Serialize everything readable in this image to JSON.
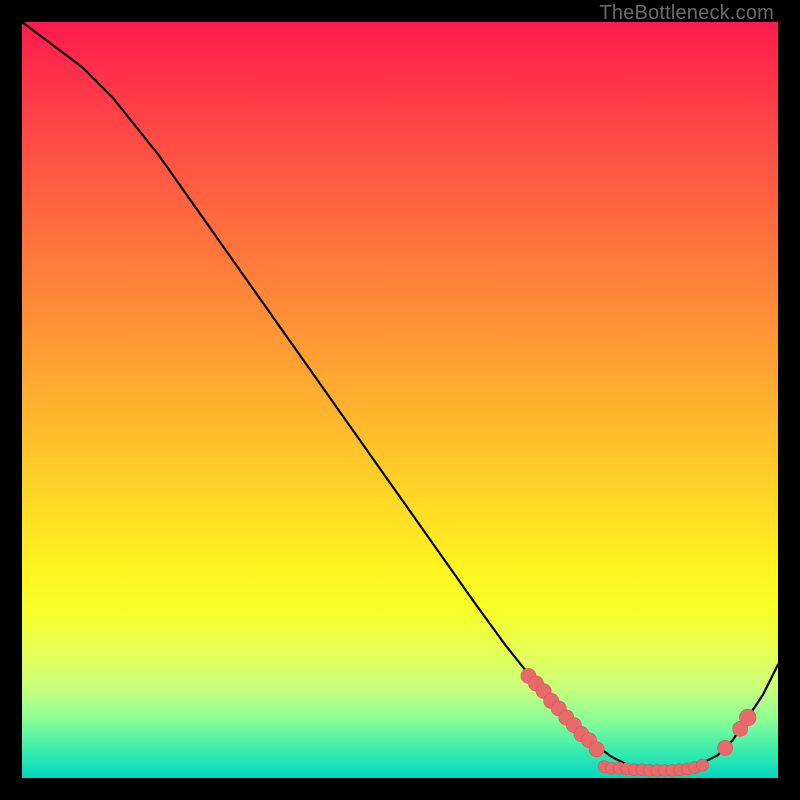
{
  "attribution": "TheBottleneck.com",
  "colors": {
    "curve_stroke": "#000000",
    "marker_fill": "#e86a6a",
    "marker_stroke": "#d45858",
    "background_black": "#000000"
  },
  "chart_data": {
    "type": "line",
    "title": "",
    "xlabel": "",
    "ylabel": "",
    "xlim": [
      0,
      100
    ],
    "ylim": [
      0,
      100
    ],
    "grid": false,
    "legend": false,
    "series": [
      {
        "name": "curve",
        "x": [
          0,
          4,
          8,
          12,
          18,
          24,
          30,
          36,
          42,
          48,
          54,
          60,
          64,
          68,
          72,
          75,
          78,
          80,
          82,
          84,
          86,
          88,
          90,
          92,
          94,
          96,
          98,
          100
        ],
        "y": [
          100,
          97,
          94,
          90,
          82.5,
          74,
          65.5,
          57,
          48.5,
          40,
          31.5,
          23,
          17.5,
          12.5,
          8,
          5,
          2.8,
          1.8,
          1.2,
          1,
          1,
          1.2,
          2,
          3,
          5,
          8,
          11,
          15
        ]
      }
    ],
    "markers": [
      {
        "x": 67,
        "y": 13.5,
        "r": 1.0
      },
      {
        "x": 68,
        "y": 12.5,
        "r": 1.0
      },
      {
        "x": 69,
        "y": 11.5,
        "r": 1.0
      },
      {
        "x": 70,
        "y": 10.2,
        "r": 1.0
      },
      {
        "x": 71,
        "y": 9.2,
        "r": 1.0
      },
      {
        "x": 72,
        "y": 8.0,
        "r": 1.0
      },
      {
        "x": 73,
        "y": 7.0,
        "r": 1.0
      },
      {
        "x": 74,
        "y": 5.8,
        "r": 1.0
      },
      {
        "x": 75,
        "y": 5.0,
        "r": 1.0
      },
      {
        "x": 76,
        "y": 3.8,
        "r": 1.0
      },
      {
        "x": 77,
        "y": 1.5,
        "r": 0.8
      },
      {
        "x": 78,
        "y": 1.3,
        "r": 0.8
      },
      {
        "x": 79,
        "y": 1.3,
        "r": 0.8
      },
      {
        "x": 80,
        "y": 1.2,
        "r": 0.8
      },
      {
        "x": 81,
        "y": 1.1,
        "r": 0.8
      },
      {
        "x": 82,
        "y": 1.1,
        "r": 0.8
      },
      {
        "x": 83,
        "y": 1.0,
        "r": 0.8
      },
      {
        "x": 84,
        "y": 1.0,
        "r": 0.8
      },
      {
        "x": 85,
        "y": 1.0,
        "r": 0.8
      },
      {
        "x": 86,
        "y": 1.0,
        "r": 0.8
      },
      {
        "x": 87,
        "y": 1.1,
        "r": 0.8
      },
      {
        "x": 88,
        "y": 1.2,
        "r": 0.8
      },
      {
        "x": 89,
        "y": 1.4,
        "r": 0.8
      },
      {
        "x": 90,
        "y": 1.7,
        "r": 0.8
      },
      {
        "x": 93,
        "y": 4.0,
        "r": 1.0
      },
      {
        "x": 95,
        "y": 6.5,
        "r": 1.0
      },
      {
        "x": 96,
        "y": 8.0,
        "r": 1.1
      }
    ]
  }
}
